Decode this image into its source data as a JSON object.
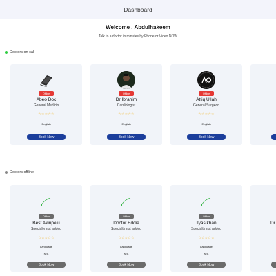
{
  "header": {
    "title": "Dashboard"
  },
  "welcome": {
    "title": "Welcome , Abdulhakeem",
    "subtitle": "Talk to a doctor in minutes by Phone or Video NOW"
  },
  "on_call": {
    "label": "Doctors on call",
    "cards": [
      {
        "name": "Abeo Doc",
        "specialty": "General Medicin",
        "status": "Offline",
        "language": "English",
        "book_label": "Book Now",
        "stars": "☆☆☆☆☆",
        "avatar_icon": "laptop-icon"
      },
      {
        "name": "Dr Ibrahim",
        "specialty": "Cardiologist",
        "status": "Offline",
        "language": "English",
        "book_label": "Book Now",
        "stars": "☆☆☆☆☆",
        "avatar_icon": "person-photo-icon"
      },
      {
        "name": "Attiq Ullah",
        "specialty": "General Surgeon",
        "status": "Offline",
        "language": "English",
        "book_label": "Book Now",
        "stars": "☆☆☆☆☆",
        "avatar_icon": "logo-icon"
      }
    ]
  },
  "offline": {
    "label": "Doctors offline",
    "cards": [
      {
        "name": "Best Akinpelu",
        "specialty": "Specialty not added",
        "status": "Offline",
        "language_label": "Language",
        "language": "N/A",
        "book_label": "Book Now",
        "stars": "☆☆☆☆☆"
      },
      {
        "name": "Doctor Eddie",
        "specialty": "Specialty not added",
        "status": "Offline",
        "language_label": "Language",
        "language": "N/A",
        "book_label": "Book Now",
        "stars": "☆☆☆☆☆"
      },
      {
        "name": "Ilyas khan",
        "specialty": "Specialty not added",
        "status": "Offline",
        "language_label": "Language",
        "language": "N/A",
        "book_label": "Book Now",
        "stars": "☆☆☆☆☆"
      }
    ],
    "partial_card_name": "Dr"
  },
  "colors": {
    "accent": "#1b3e9c",
    "offline_badge_red": "#e53935",
    "offline_badge_grey": "#6b6b6b",
    "online_dot": "#2ecc40",
    "star": "#f2a900"
  }
}
